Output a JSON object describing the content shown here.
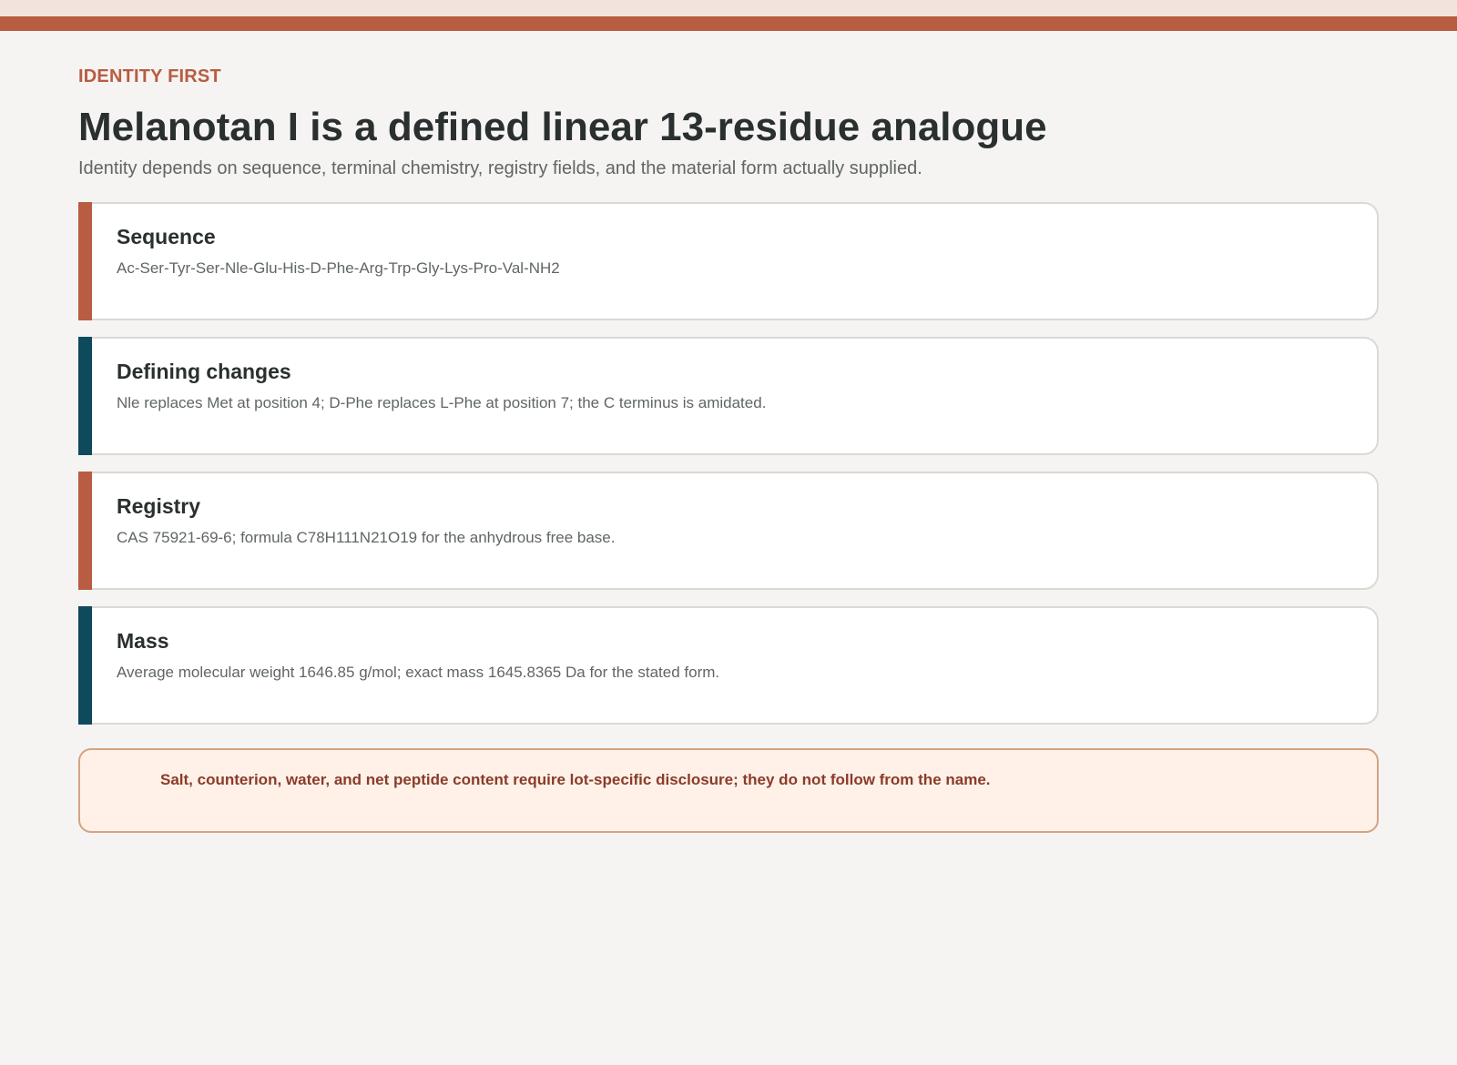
{
  "header": {
    "eyebrow": "IDENTITY FIRST",
    "title": "Melanotan I is a defined linear 13-residue analogue",
    "subtitle": "Identity depends on sequence, terminal chemistry, registry fields, and the material form actually supplied."
  },
  "cards": [
    {
      "title": "Sequence",
      "body": "Ac-Ser-Tyr-Ser-Nle-Glu-His-D-Phe-Arg-Trp-Gly-Lys-Pro-Val-NH2",
      "accent": "#b85c42"
    },
    {
      "title": "Defining changes",
      "body": "Nle replaces Met at position 4; D-Phe replaces L-Phe at position 7; the C terminus is amidated.",
      "accent": "#0f4a5c"
    },
    {
      "title": "Registry",
      "body": "CAS 75921-69-6; formula C78H111N21O19 for the anhydrous free base.",
      "accent": "#b85c42"
    },
    {
      "title": "Mass",
      "body": "Average molecular weight 1646.85 g/mol; exact mass 1645.8365 Da for the stated form.",
      "accent": "#0f4a5c"
    }
  ],
  "notice": {
    "text": "Salt, counterion, water, and net peptide content require lot-specific disclosure; they do not follow from the name."
  },
  "colors": {
    "accent_rust": "#b85c42",
    "accent_teal": "#0f4a5c",
    "notice_background": "#fff1e7",
    "notice_text": "#8a3b2a"
  }
}
